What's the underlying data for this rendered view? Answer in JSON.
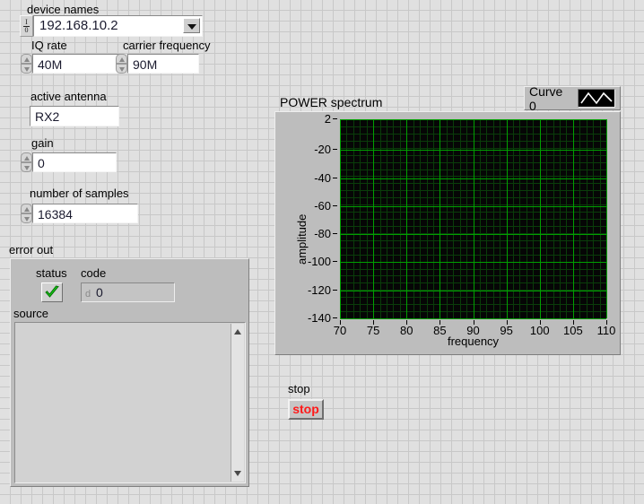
{
  "controls": {
    "device_names": {
      "label": "device names",
      "value": "192.168.10.2",
      "glyph": "io-glyph"
    },
    "iq_rate": {
      "label": "IQ rate",
      "value": "40M"
    },
    "carrier_frequency": {
      "label": "carrier frequency",
      "value": "90M"
    },
    "active_antenna": {
      "label": "active antenna",
      "value": "RX2"
    },
    "gain": {
      "label": "gain",
      "value": "0"
    },
    "number_of_samples": {
      "label": "number of samples",
      "value": "16384"
    }
  },
  "error_out": {
    "label": "error out",
    "status_label": "status",
    "status_value": "false",
    "status_icon": "green-check-icon",
    "code_label": "code",
    "code_prefix": "d",
    "code_value": "0",
    "source_label": "source",
    "source_value": ""
  },
  "graph": {
    "title": "POWER spectrum",
    "legend": {
      "name": "Curve 0",
      "icon": "waveform-icon"
    }
  },
  "stop": {
    "label": "stop",
    "button_label": "stop",
    "color": "#ff1a1a"
  },
  "chart_data": {
    "type": "line",
    "title": "POWER spectrum",
    "xlabel": "frequency",
    "ylabel": "amplitude",
    "xlim": [
      70,
      110
    ],
    "ylim": [
      -140,
      2
    ],
    "xticks": [
      70,
      75,
      80,
      85,
      90,
      95,
      100,
      105,
      110
    ],
    "yticks": [
      2,
      -20,
      -40,
      -60,
      -80,
      -100,
      -120,
      -140
    ],
    "grid": true,
    "grid_color": "#00a000",
    "minor_grid_color": "#0a3d0a",
    "plot_bg": "#060606",
    "legend": [
      "Curve 0"
    ],
    "legend_position": "top-right",
    "series": [
      {
        "name": "Curve 0",
        "color": "#ffffff",
        "x": [],
        "values": []
      }
    ]
  }
}
